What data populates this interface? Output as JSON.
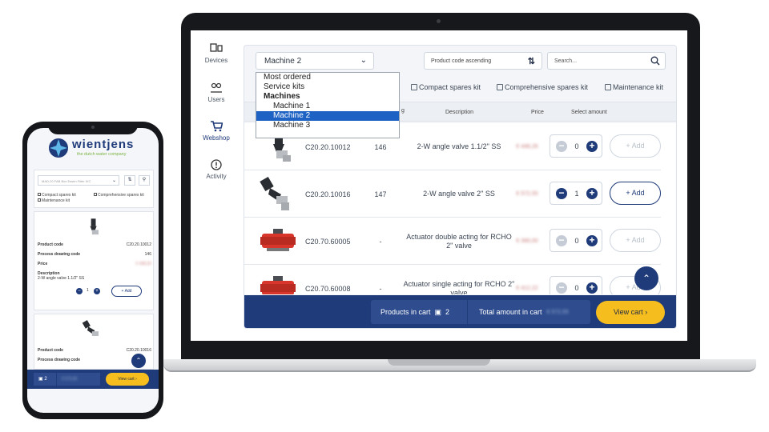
{
  "sidebar": {
    "items": [
      {
        "label": "Devices"
      },
      {
        "label": "Users"
      },
      {
        "label": "Webshop"
      },
      {
        "label": "Activity"
      }
    ]
  },
  "toolbar": {
    "machine_select": "Machine 2",
    "sort_select": "Product code ascending",
    "search_placeholder": "Search..."
  },
  "dropdown": {
    "options": [
      "Most ordered",
      "Service kits",
      "Machines",
      "Machine 1",
      "Machine 2",
      "Machine 3"
    ]
  },
  "kit_filters": [
    "Compact spares kit",
    "Comprehensive spares kit",
    "Maintenance kit"
  ],
  "table": {
    "headers": {
      "process_partial": "g",
      "description": "Description",
      "price": "Price",
      "select_amount": "Select amount"
    },
    "rows": [
      {
        "code": "C20.20.10012",
        "process_code": "146",
        "description": "2-W angle valve 1.1/2\" SS",
        "price": "€ 448,26",
        "qty": "0",
        "add": "+ Add",
        "active": false
      },
      {
        "code": "C20.20.10016",
        "process_code": "147",
        "description": "2-W angle valve 2\" SS",
        "price": "€ 572,55",
        "qty": "1",
        "add": "+ Add",
        "active": true
      },
      {
        "code": "C20.70.60005",
        "process_code": "-",
        "description": "Actuator double acting for RCHO 2\" valve",
        "price": "€ 390,00",
        "qty": "0",
        "add": "+ Add",
        "active": false
      },
      {
        "code": "C20.70.60008",
        "process_code": "-",
        "description": "Actuator single acting for RCHO 2\" valve",
        "price": "€ 412,22",
        "qty": "0",
        "add": "+ Add",
        "active": false
      }
    ]
  },
  "footer": {
    "products_in_cart_label": "Products in cart",
    "products_in_cart_count": "2",
    "total_label": "Total amount in cart",
    "total_value": "€ 572,55",
    "view_cart": "View cart"
  },
  "mobile": {
    "brand": "wientjens",
    "tagline": "the dutch water company",
    "select_value": "MAD-20 FAB Box Essen Filter IVC",
    "kits": [
      "Compact spares kit",
      "Comprehensive spares kit",
      "Maintenance kit"
    ],
    "item1": {
      "product_code_label": "Product code",
      "product_code": "C20.20.10012",
      "pdc_label": "Process drawing code",
      "pdc": "146",
      "price_label": "Price",
      "price": "€ 448,26",
      "desc_label": "Description",
      "desc": "2-W angle valve 1.1/2\" SS",
      "qty": "1",
      "add": "+ Add"
    },
    "item2": {
      "product_code_label": "Product code",
      "product_code": "C20.20.10016",
      "pdc_label": "Process drawing code"
    },
    "cart_count": "2",
    "cart_total": "€ 572,55",
    "view_cart": "View cart"
  },
  "colors": {
    "brand_blue": "#1f3b7a",
    "accent_yellow": "#f5bd1e",
    "selection_blue": "#1e63c4"
  }
}
